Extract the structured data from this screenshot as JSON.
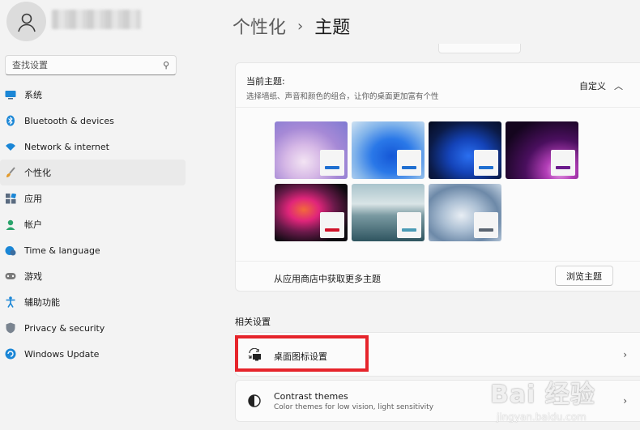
{
  "sidebar": {
    "search": {
      "placeholder": "查找设置"
    },
    "items": [
      {
        "label": "系统",
        "icon": "monitor-icon"
      },
      {
        "label": "Bluetooth & devices",
        "icon": "bluetooth-icon"
      },
      {
        "label": "Network & internet",
        "icon": "wifi-icon"
      },
      {
        "label": "个性化",
        "icon": "brush-icon",
        "active": true
      },
      {
        "label": "应用",
        "icon": "apps-icon"
      },
      {
        "label": "帐户",
        "icon": "person-icon"
      },
      {
        "label": "Time & language",
        "icon": "globe-clock-icon"
      },
      {
        "label": "游戏",
        "icon": "gamepad-icon"
      },
      {
        "label": "辅助功能",
        "icon": "accessibility-icon"
      },
      {
        "label": "Privacy & security",
        "icon": "shield-icon"
      },
      {
        "label": "Windows Update",
        "icon": "update-icon"
      }
    ]
  },
  "header": {
    "parent": "个性化",
    "separator": "›",
    "current": "主题"
  },
  "current_theme": {
    "title": "当前主题:",
    "description": "选择墙纸、声音和颜色的组合，让你的桌面更加富有个性",
    "value": "自定义",
    "themes": [
      {
        "accent": "#1f6fd1"
      },
      {
        "accent": "#1f6fd1"
      },
      {
        "accent": "#1f6fd1"
      },
      {
        "accent": "#6b1a8c"
      },
      {
        "accent": "#d0122a"
      },
      {
        "accent": "#4b9bb6"
      },
      {
        "accent": "#5a6470"
      }
    ],
    "store_text": "从应用商店中获取更多主题",
    "browse_button": "浏览主题"
  },
  "related": {
    "label": "相关设置",
    "desktop_icons": {
      "title": "桌面图标设置",
      "icon": "desktop-icon-settings-icon"
    },
    "contrast": {
      "title": "Contrast themes",
      "subtitle": "Color themes for low vision, light sensitivity",
      "icon": "contrast-icon"
    }
  },
  "watermark": {
    "logo": "Bai 经验",
    "url": "jingyan.baidu.com"
  },
  "colors": {
    "highlight": "#e6242b",
    "accent": "#0067c0"
  }
}
